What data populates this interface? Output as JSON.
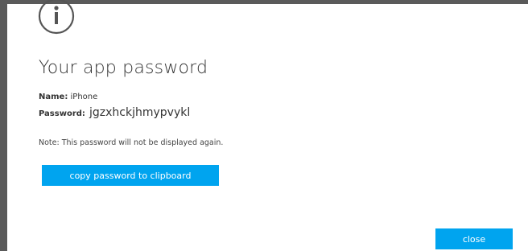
{
  "dialog": {
    "title": "Your app password",
    "name_label": "Name:",
    "name_value": "iPhone",
    "password_label": "Password:",
    "password_value": "jgzxhckjhmypvykl",
    "note": "Note: This password will not be displayed again.",
    "copy_button_label": "copy password to clipboard",
    "close_button_label": "close",
    "icon": "info-icon"
  },
  "colors": {
    "accent": "#00a4ef",
    "frame": "#5a5a5a",
    "text": "#333333"
  }
}
